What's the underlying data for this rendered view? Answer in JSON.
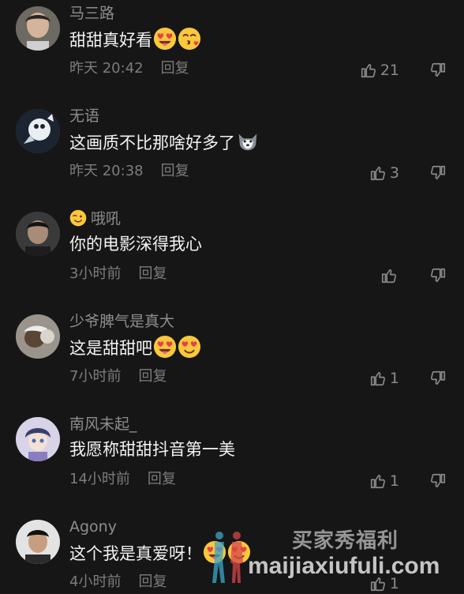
{
  "comments": [
    {
      "user": "马三路",
      "text": "甜甜真好看",
      "emojis": [
        "heart-eyes-tongue",
        "kiss-heart"
      ],
      "time": "昨天 20:42",
      "reply": "回复",
      "likes": "21"
    },
    {
      "user": "无语",
      "text": "这画质不比那啥好多了",
      "emojis": [
        "husky"
      ],
      "time": "昨天 20:38",
      "reply": "回复",
      "likes": "3"
    },
    {
      "user": "哦吼",
      "user_emoji": "wink",
      "text": "你的电影深得我心",
      "emojis": [],
      "time": "3小时前",
      "reply": "回复",
      "likes": ""
    },
    {
      "user": "少爷脾气是真大",
      "text": "这是甜甜吧",
      "emojis": [
        "heart-eyes-tongue",
        "heart-eyes"
      ],
      "time": "7小时前",
      "reply": "回复",
      "likes": "1"
    },
    {
      "user": "南风未起_",
      "text": "我愿称甜甜抖音第一美",
      "emojis": [],
      "time": "14小时前",
      "reply": "回复",
      "likes": "1"
    },
    {
      "user": "Agony",
      "text": "这个我是真爱呀！",
      "emojis": [
        "heart-eyes-tongue",
        "heart-eyes"
      ],
      "time": "4小时前",
      "reply": "回复",
      "likes": "1"
    }
  ],
  "watermark": {
    "cn": "买家秀福利",
    "en": "maijiaxiufuli.com"
  }
}
